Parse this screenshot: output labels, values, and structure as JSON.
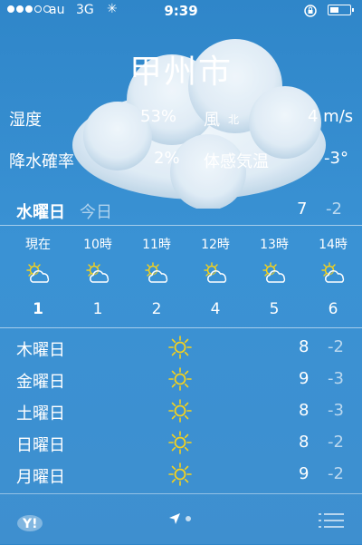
{
  "status": {
    "carrier": "au",
    "network": "3G",
    "time": "9:39"
  },
  "city": "甲州市",
  "details": {
    "humidity": {
      "label": "湿度",
      "value": "53%"
    },
    "wind": {
      "label": "風",
      "direction": "北",
      "value": "4 m/s"
    },
    "precip": {
      "label": "降水確率",
      "value": "2%"
    },
    "feels": {
      "label": "体感気温",
      "value": "-3°"
    }
  },
  "today": {
    "day": "水曜日",
    "label": "今日",
    "high": "7",
    "low": "-2"
  },
  "hourly": [
    {
      "label": "現在",
      "temp": "1",
      "icon": "partly-sunny-icon"
    },
    {
      "label": "10時",
      "temp": "1",
      "icon": "partly-sunny-icon"
    },
    {
      "label": "11時",
      "temp": "2",
      "icon": "partly-sunny-icon"
    },
    {
      "label": "12時",
      "temp": "4",
      "icon": "partly-sunny-icon"
    },
    {
      "label": "13時",
      "temp": "5",
      "icon": "partly-sunny-icon"
    },
    {
      "label": "14時",
      "temp": "6",
      "icon": "partly-sunny-icon"
    }
  ],
  "daily": [
    {
      "day": "木曜日",
      "high": "8",
      "low": "-2",
      "icon": "sun-icon"
    },
    {
      "day": "金曜日",
      "high": "9",
      "low": "-3",
      "icon": "sun-icon"
    },
    {
      "day": "土曜日",
      "high": "8",
      "low": "-3",
      "icon": "sun-icon"
    },
    {
      "day": "日曜日",
      "high": "8",
      "low": "-2",
      "icon": "sun-icon"
    },
    {
      "day": "月曜日",
      "high": "9",
      "low": "-2",
      "icon": "sun-icon"
    }
  ],
  "footer": {
    "brand": "Y!"
  },
  "colors": {
    "sky": "#3a92d4",
    "sun": "#f5d21c"
  }
}
